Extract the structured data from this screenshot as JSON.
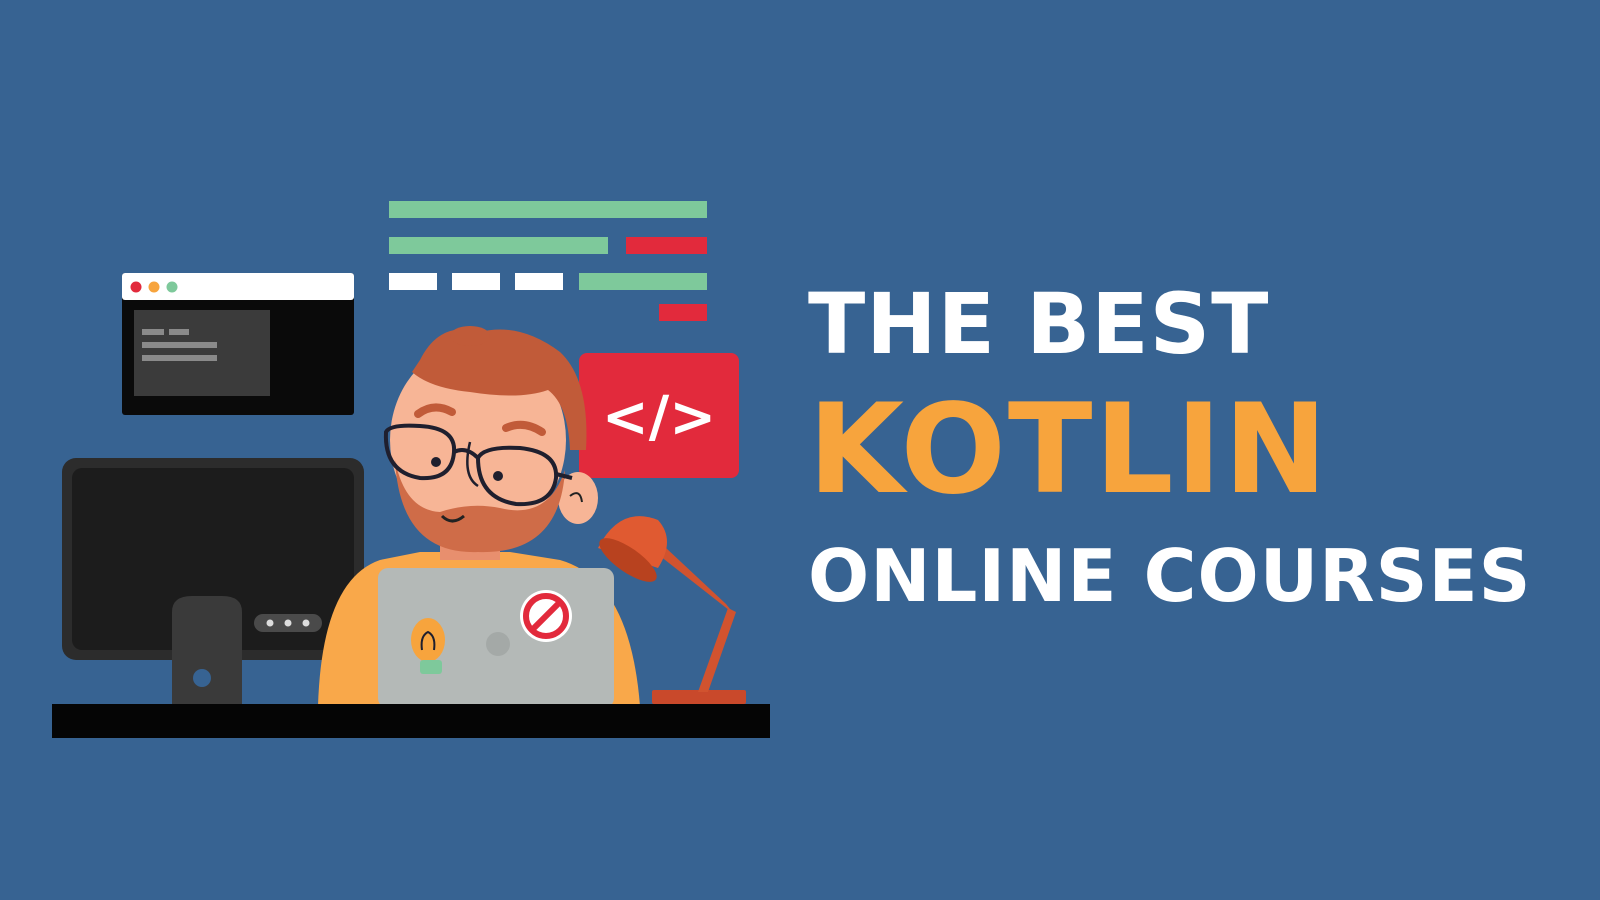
{
  "headline": {
    "line1": "THE BEST",
    "line2": "KOTLIN",
    "line3": "ONLINE COURSES"
  },
  "code_badge": "</>",
  "colors": {
    "background": "#376392",
    "accent_orange": "#f7a43d",
    "text_white": "#ffffff",
    "code_green": "#7ec99b",
    "code_red": "#e22a3c"
  }
}
